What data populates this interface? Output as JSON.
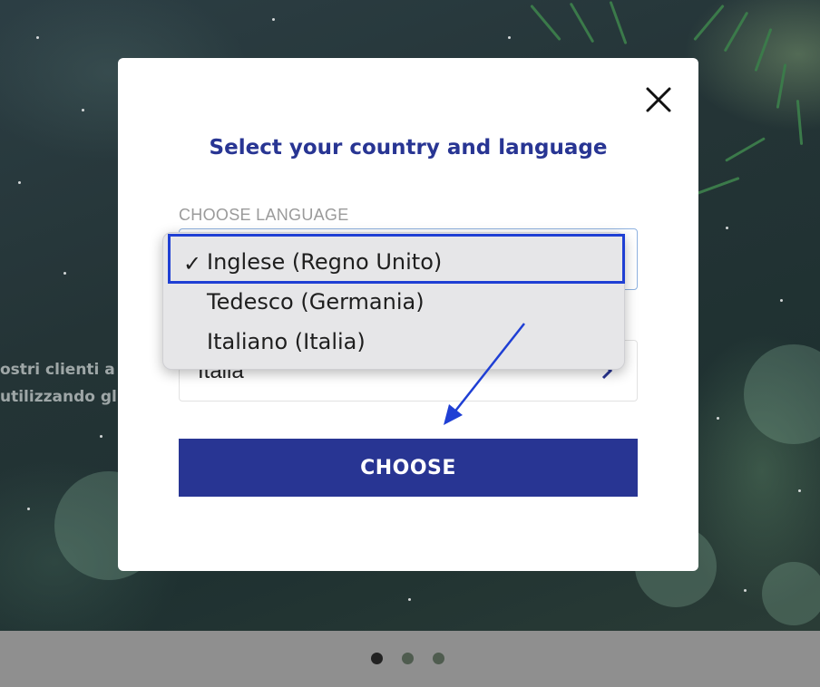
{
  "background": {
    "text_line_1": "ostri clienti a v",
    "text_line_2": "utilizzando gl"
  },
  "modal": {
    "title": "Select your country and language",
    "language_label": "CHOOSE LANGUAGE",
    "country_value": "Italia",
    "choose_button": "CHOOSE",
    "close_icon": "close-icon"
  },
  "language_dropdown": {
    "selected_index": 0,
    "options": [
      {
        "label": "Inglese (Regno Unito)",
        "selected": true
      },
      {
        "label": "Tedesco (Germania)",
        "selected": false
      },
      {
        "label": "Italiano (Italia)",
        "selected": false
      }
    ],
    "check_mark": "✓"
  },
  "carousel": {
    "dot_count": 3,
    "active_index": 0
  },
  "colors": {
    "primary": "#283593",
    "highlight": "#1f3fd4",
    "active_dot": "#222222",
    "inactive_dot": "#4f5c4f"
  }
}
